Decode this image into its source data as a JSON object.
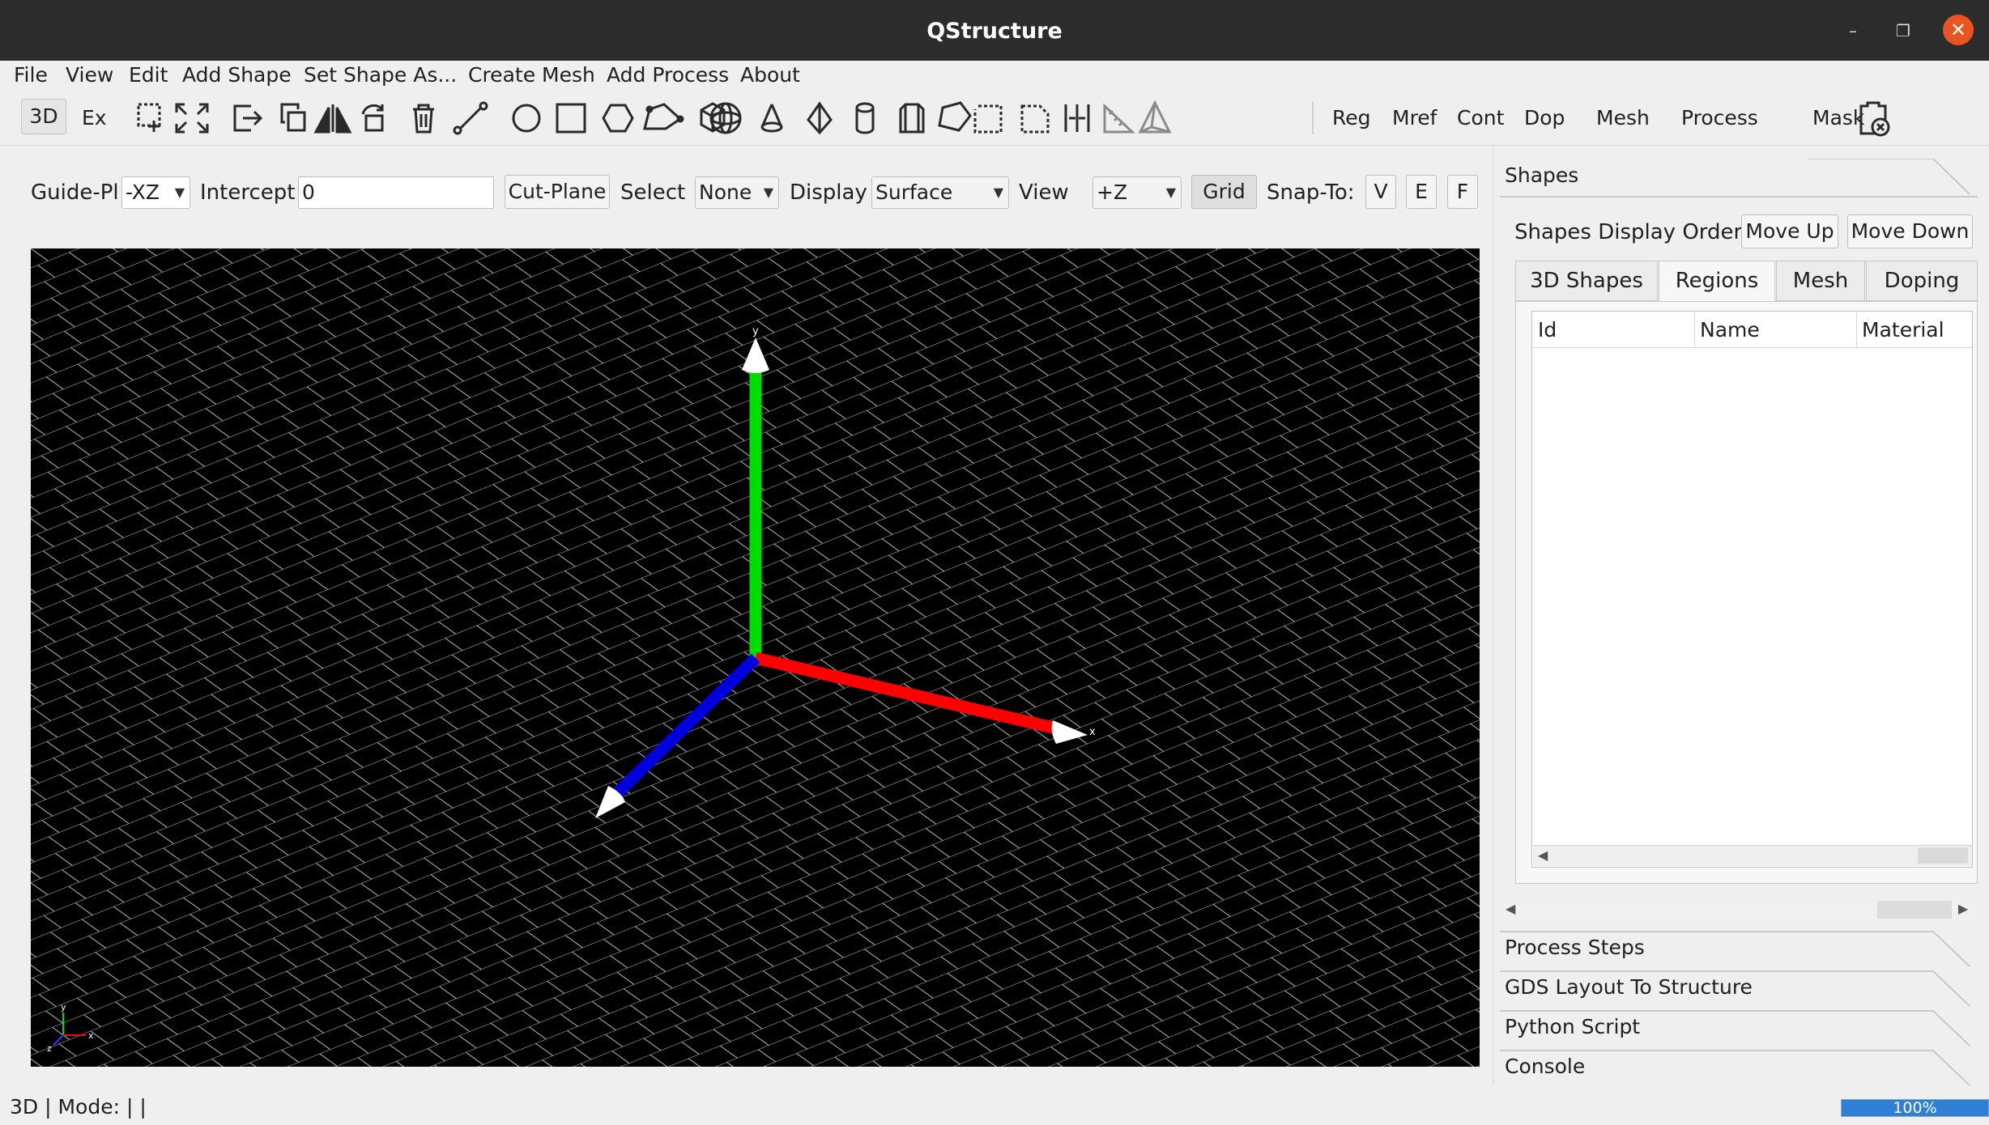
{
  "window": {
    "title": "QStructure"
  },
  "menu": [
    "File",
    "View",
    "Edit",
    "Add Shape",
    "Set Shape As...",
    "Create Mesh",
    "Add Process",
    "About"
  ],
  "toolbar": {
    "mode_3d": "3D",
    "mode_ex": "Ex",
    "text_buttons": [
      "Reg",
      "Mref",
      "Cont",
      "Dop",
      "Mesh",
      "Process",
      "Mask"
    ]
  },
  "controls": {
    "guide_plane_label": "Guide-Pl",
    "guide_plane_value": "-XZ",
    "intercept_label": "Intercept",
    "intercept_value": "0",
    "cut_plane_button": "Cut-Plane",
    "select_label": "Select",
    "select_value": "None",
    "display_label": "Display",
    "display_value": "Surface",
    "view_label": "View",
    "view_value": "+Z",
    "grid_button": "Grid",
    "snap_label": "Snap-To:",
    "snap_v": "V",
    "snap_e": "E",
    "snap_f": "F"
  },
  "viewport": {
    "axis_x": "x",
    "axis_y": "y",
    "axis_z": "z",
    "colors": {
      "x": "#ff0000",
      "y": "#00dd00",
      "z": "#0000dd",
      "grid": "#ffffff"
    }
  },
  "panel": {
    "shapes_header": "Shapes",
    "display_order_label": "Shapes Display Order:",
    "move_up": "Move Up",
    "move_down": "Move Down",
    "tabs": [
      "3D Shapes",
      "Regions",
      "Mesh",
      "Doping"
    ],
    "active_tab": "Regions",
    "columns": [
      "Id",
      "Name",
      "Material"
    ],
    "sections": [
      "Process Steps",
      "GDS Layout To Structure",
      "Python Script",
      "Console"
    ]
  },
  "status": {
    "text": "3D |  Mode: |  |",
    "progress_label": "100%",
    "progress_value": 1.0
  }
}
